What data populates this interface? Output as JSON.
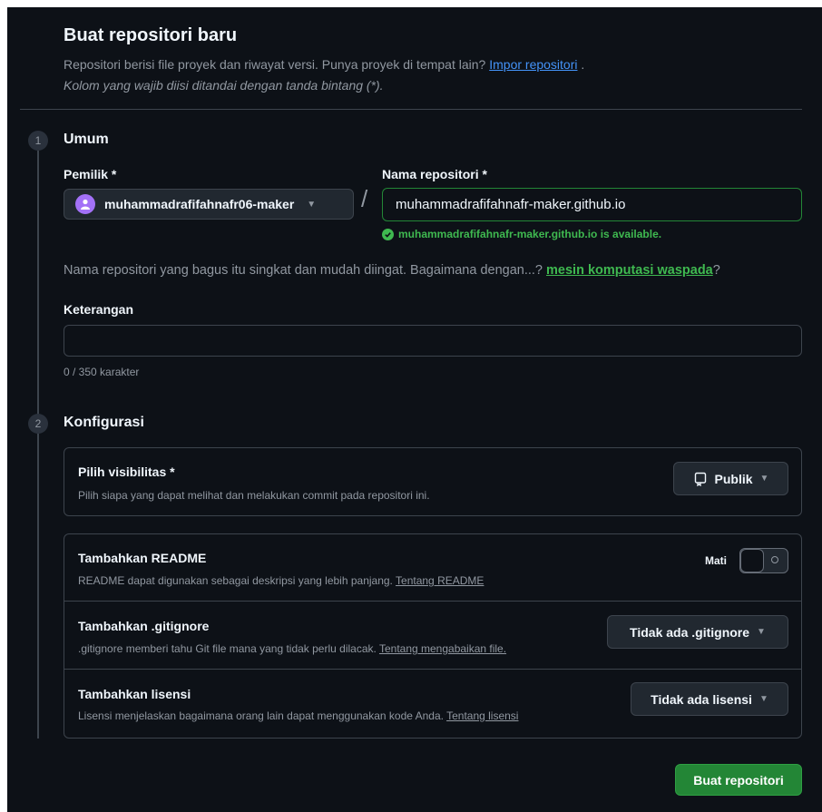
{
  "header": {
    "title": "Buat repositori baru",
    "subtitle": "Repositori berisi file proyek dan riwayat versi. Punya proyek di tempat lain?",
    "import_link": "Impor repositori",
    "subtitle_end": ".",
    "required_note": "Kolom yang wajib diisi ditandai dengan tanda bintang (*)."
  },
  "general": {
    "step": "1",
    "title": "Umum",
    "owner_label": "Pemilik *",
    "owner_value": "muhammadrafifahnafr06-maker",
    "slash": "/",
    "repo_name_label": "Nama repositori *",
    "repo_name_value": "muhammadrafifahnafr-maker.github.io",
    "availability": "muhammadrafifahnafr-maker.github.io is available.",
    "hint_prefix": "Nama repositori yang bagus itu singkat dan mudah diingat. Bagaimana dengan...?",
    "hint_suggestion": "mesin komputasi waspada",
    "hint_suffix": "?",
    "description_label": "Keterangan",
    "description_value": "",
    "char_counter": "0 / 350 karakter"
  },
  "config": {
    "step": "2",
    "title": "Konfigurasi",
    "visibility": {
      "title": "Pilih visibilitas *",
      "desc": "Pilih siapa yang dapat melihat dan melakukan commit pada repositori ini.",
      "selected": "Publik",
      "icon": "repo-icon"
    },
    "readme": {
      "title": "Tambahkan README",
      "desc": "README dapat digunakan sebagai deskripsi yang lebih panjang.",
      "link": "Tentang README",
      "toggle_label": "Mati",
      "enabled": false
    },
    "gitignore": {
      "title": "Tambahkan .gitignore",
      "desc": ".gitignore memberi tahu Git file mana yang tidak perlu dilacak.",
      "link": "Tentang mengabaikan file.",
      "selected": "Tidak ada .gitignore"
    },
    "license": {
      "title": "Tambahkan lisensi",
      "desc": "Lisensi menjelaskan bagaimana orang lain dapat menggunakan kode Anda.",
      "link": "Tentang lisensi",
      "selected": "Tidak ada lisensi"
    }
  },
  "actions": {
    "create_label": "Buat repositori"
  },
  "colors": {
    "background": "#0d1117",
    "accent_green": "#238636",
    "success_text": "#3fb950",
    "link_blue": "#4493f8",
    "border": "#3d444d"
  }
}
